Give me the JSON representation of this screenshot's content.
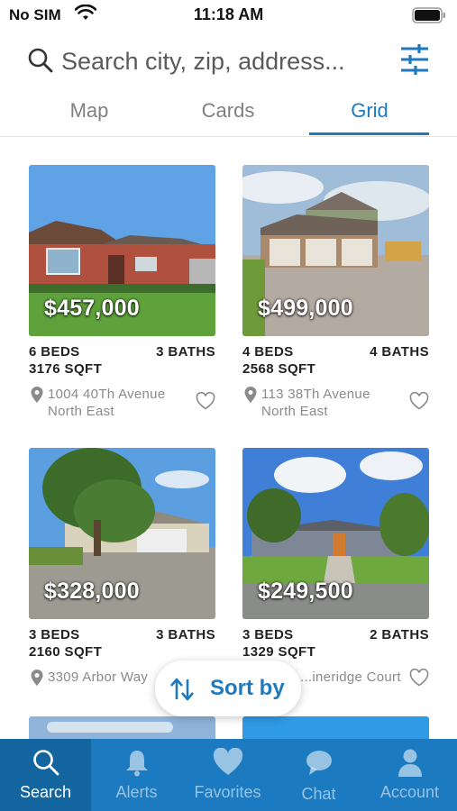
{
  "status": {
    "carrier": "No SIM",
    "time": "11:18 AM"
  },
  "search": {
    "placeholder": "Search city, zip, address..."
  },
  "tabs": [
    {
      "label": "Map"
    },
    {
      "label": "Cards"
    },
    {
      "label": "Grid",
      "active": true
    }
  ],
  "listings": [
    {
      "price": "$457,000",
      "beds": "6 BEDS",
      "baths": "3 BATHS",
      "sqft": "3176 SQFT",
      "address": "1004 40Th Avenue North East"
    },
    {
      "price": "$499,000",
      "beds": "4 BEDS",
      "baths": "4 BATHS",
      "sqft": "2568 SQFT",
      "address": "113 38Th Avenue North East"
    },
    {
      "price": "$328,000",
      "beds": "3 BEDS",
      "baths": "3 BATHS",
      "sqft": "2160 SQFT",
      "address": "3309 Arbor Way"
    },
    {
      "price": "$249,500",
      "beds": "3 BEDS",
      "baths": "2 BATHS",
      "sqft": "1329 SQFT",
      "address": "...ineridge Court"
    }
  ],
  "sort": {
    "label": "Sort by"
  },
  "nav": [
    {
      "label": "Search",
      "icon": "search-icon",
      "active": true
    },
    {
      "label": "Alerts",
      "icon": "bell-icon"
    },
    {
      "label": "Favorites",
      "icon": "heart-icon"
    },
    {
      "label": "Chat",
      "icon": "chat-icon"
    },
    {
      "label": "Account",
      "icon": "account-icon"
    }
  ],
  "colors": {
    "accent": "#1f79be",
    "nav_bg": "#1b7ac0"
  }
}
